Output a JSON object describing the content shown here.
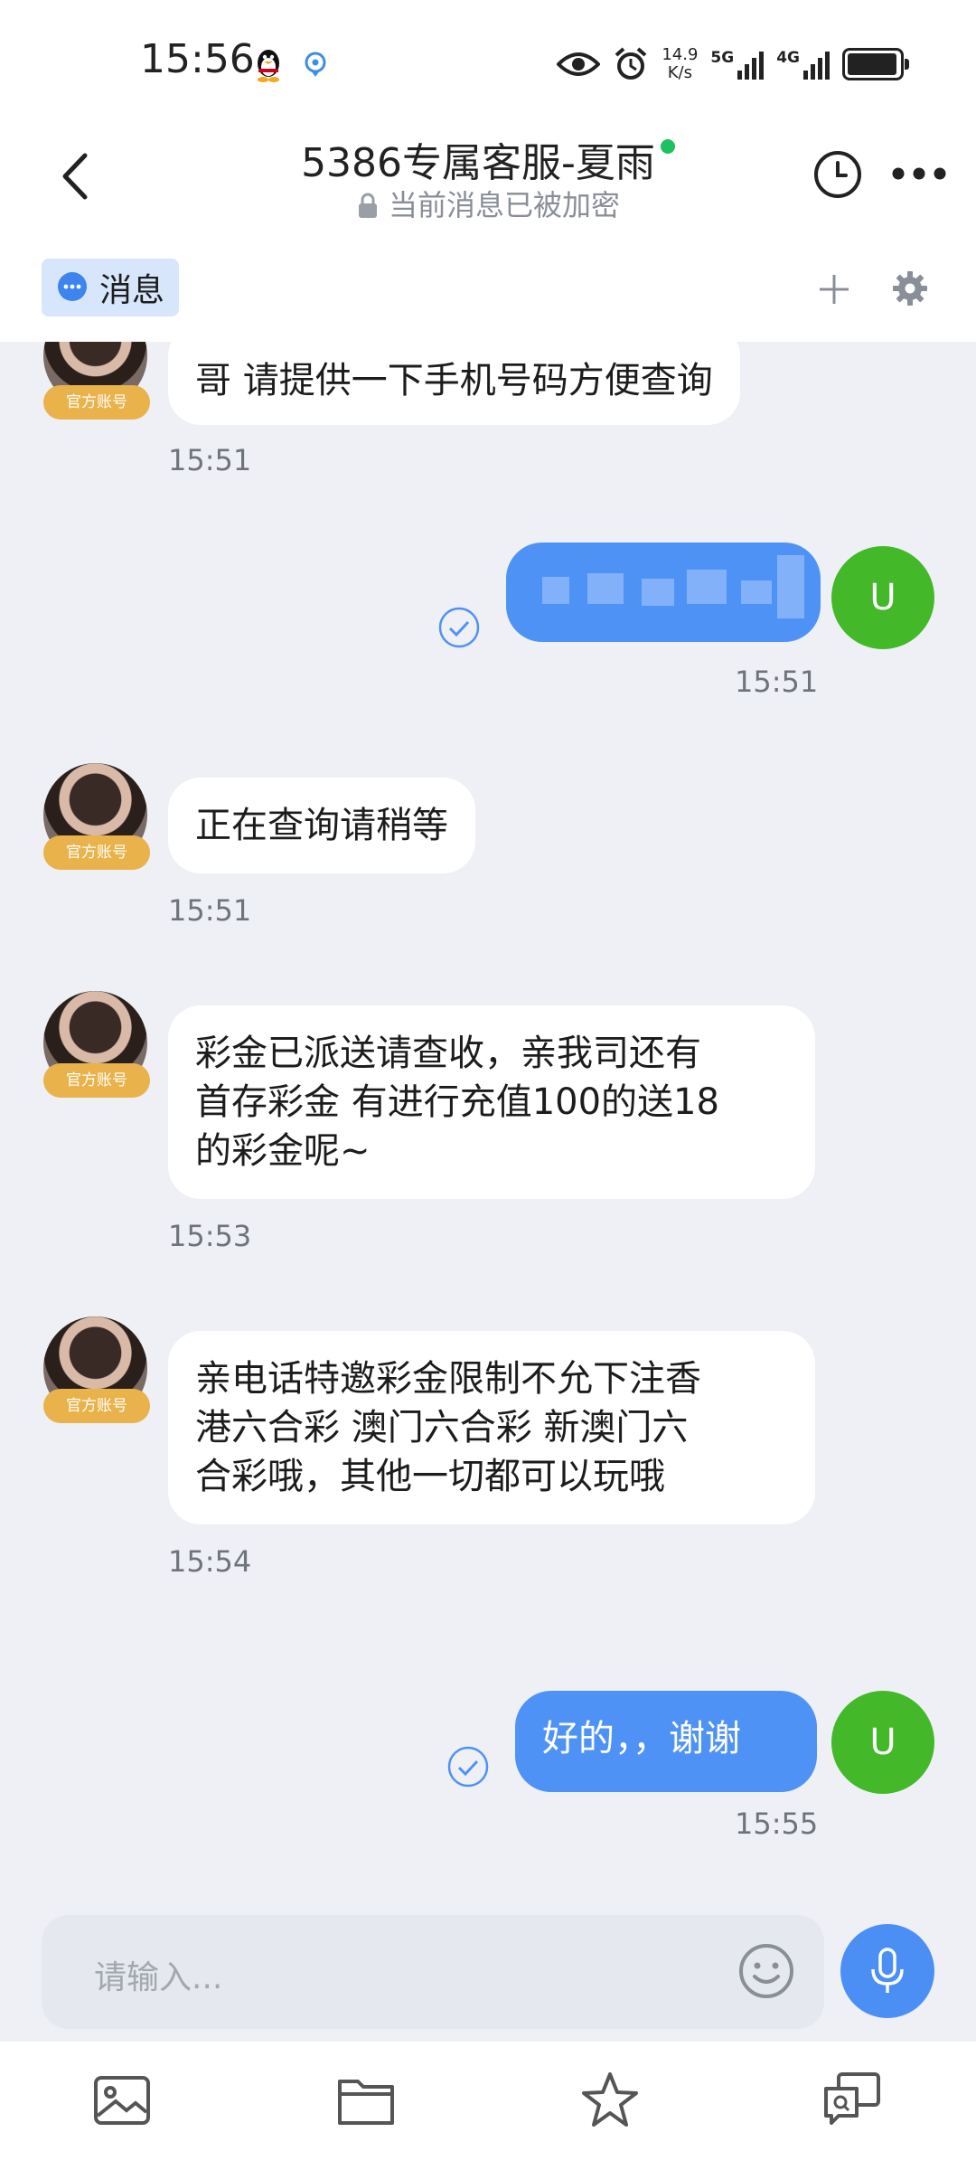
{
  "status": {
    "time": "15:56",
    "net_speed_value": "14.9",
    "net_speed_unit": "K/s",
    "net1": "5G",
    "net2": "4G"
  },
  "header": {
    "title": "5386专属客服-夏雨",
    "subtitle": "当前消息已被加密"
  },
  "tabs": {
    "message_label": "消息"
  },
  "messages": [
    {
      "side": "in",
      "badge": "官方账号",
      "text": "哥 请提供一下手机号码方便查询",
      "time": "15:51"
    },
    {
      "side": "out",
      "avatar": "U",
      "text": "",
      "time": "15:51"
    },
    {
      "side": "in",
      "badge": "官方账号",
      "text": "正在查询请稍等",
      "time": "15:51"
    },
    {
      "side": "in",
      "badge": "官方账号",
      "lines": [
        "彩金已派送请查收，亲我司还有",
        "首存彩金 有进行充值100的送18",
        "的彩金呢~"
      ],
      "time": "15:53"
    },
    {
      "side": "in",
      "badge": "官方账号",
      "lines": [
        "亲电话特邀彩金限制不允下注香",
        "港六合彩 澳门六合彩  新澳门六",
        "合彩哦，其他一切都可以玩哦"
      ],
      "time": "15:54"
    },
    {
      "side": "out",
      "avatar": "U",
      "text": "好的，，谢谢",
      "time": "15:55"
    }
  ],
  "input": {
    "placeholder": "请输入..."
  },
  "colors": {
    "accent": "#4f92f5",
    "online": "#1ec15f",
    "badge": "#e9b24a",
    "user_avatar": "#43b829",
    "background": "#eef0f5"
  },
  "icons": [
    "back-icon",
    "history-icon",
    "more-icon",
    "message-tab-icon",
    "plus-icon",
    "gear-icon",
    "check-icon",
    "emoji-icon",
    "mic-icon",
    "image-icon",
    "folder-icon",
    "star-icon",
    "chat-search-icon"
  ]
}
